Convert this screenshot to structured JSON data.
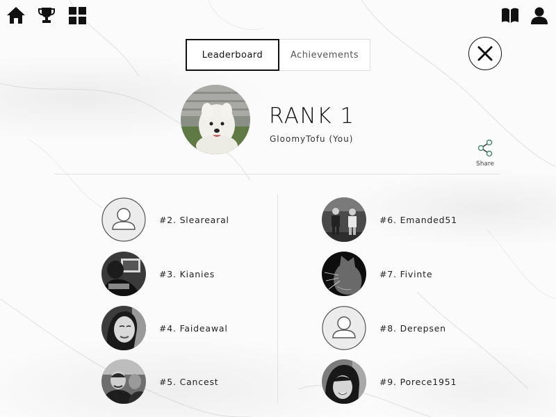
{
  "nav": {
    "left_icons": [
      "home-icon",
      "trophy-icon",
      "grid-icon"
    ],
    "right_icons": [
      "book-icon",
      "profile-icon"
    ]
  },
  "tabs": [
    {
      "label": "Leaderboard",
      "active": true
    },
    {
      "label": "Achievements",
      "active": false
    }
  ],
  "current_user": {
    "rank_label": "RANK 1",
    "username": "GloomyTofu (You)"
  },
  "share": {
    "label": "Share"
  },
  "leaderboard": [
    {
      "label": "#2. Slearearal",
      "avatar": "placeholder"
    },
    {
      "label": "#3. Kianies",
      "avatar": "photo"
    },
    {
      "label": "#4. Faideawal",
      "avatar": "photo"
    },
    {
      "label": "#5. Cancest",
      "avatar": "photo"
    },
    {
      "label": "#6. Emanded51",
      "avatar": "photo"
    },
    {
      "label": "#7. Fivinte",
      "avatar": "photo"
    },
    {
      "label": "#8. Derepsen",
      "avatar": "placeholder"
    },
    {
      "label": "#9. Porece1951",
      "avatar": "photo"
    }
  ],
  "colors": {
    "accent": "#111111",
    "share_icon": "#4a8a6a"
  }
}
